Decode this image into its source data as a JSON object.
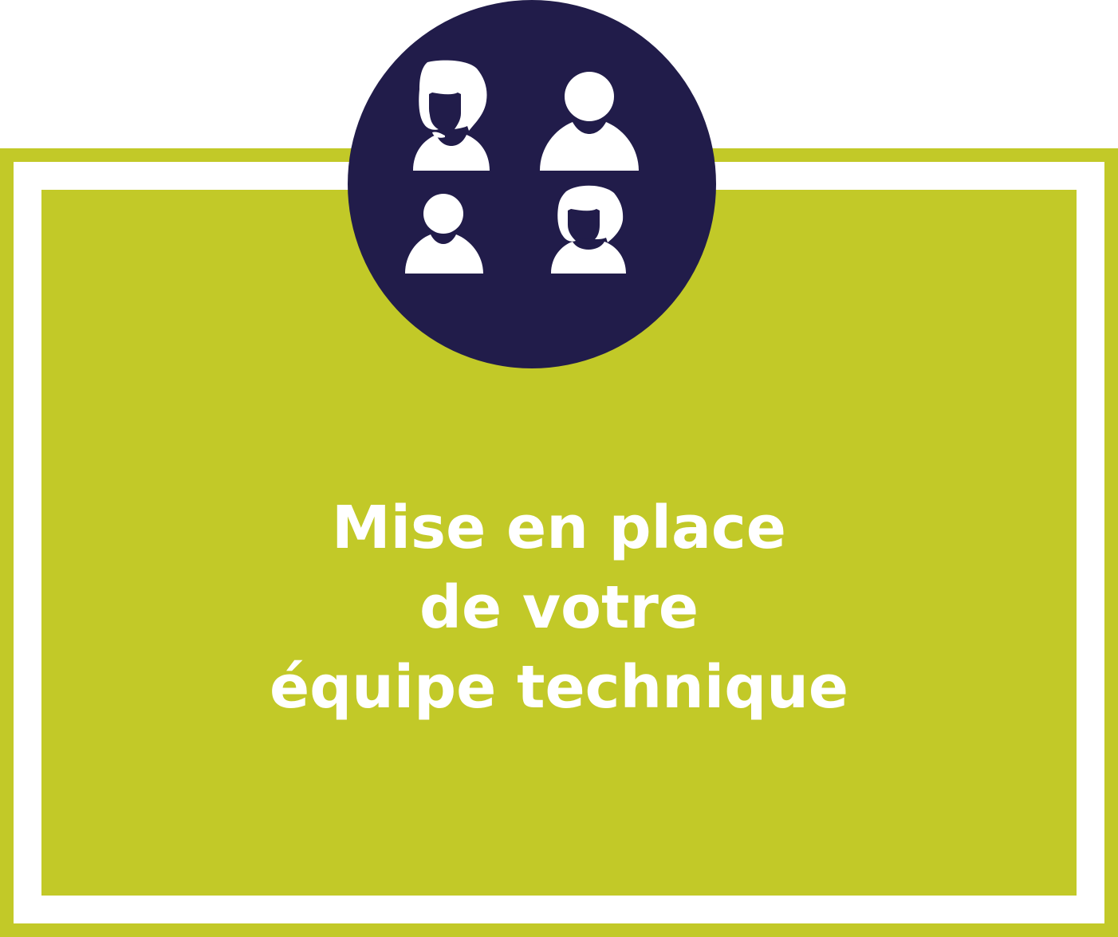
{
  "colors": {
    "green": "#c2c928",
    "navy": "#211c4a",
    "white": "#ffffff"
  },
  "icons": [
    "woman-icon",
    "man-icon",
    "man-icon",
    "woman-icon"
  ],
  "title": {
    "line1": "Mise en place",
    "line2": "de votre",
    "line3": "équipe technique"
  }
}
